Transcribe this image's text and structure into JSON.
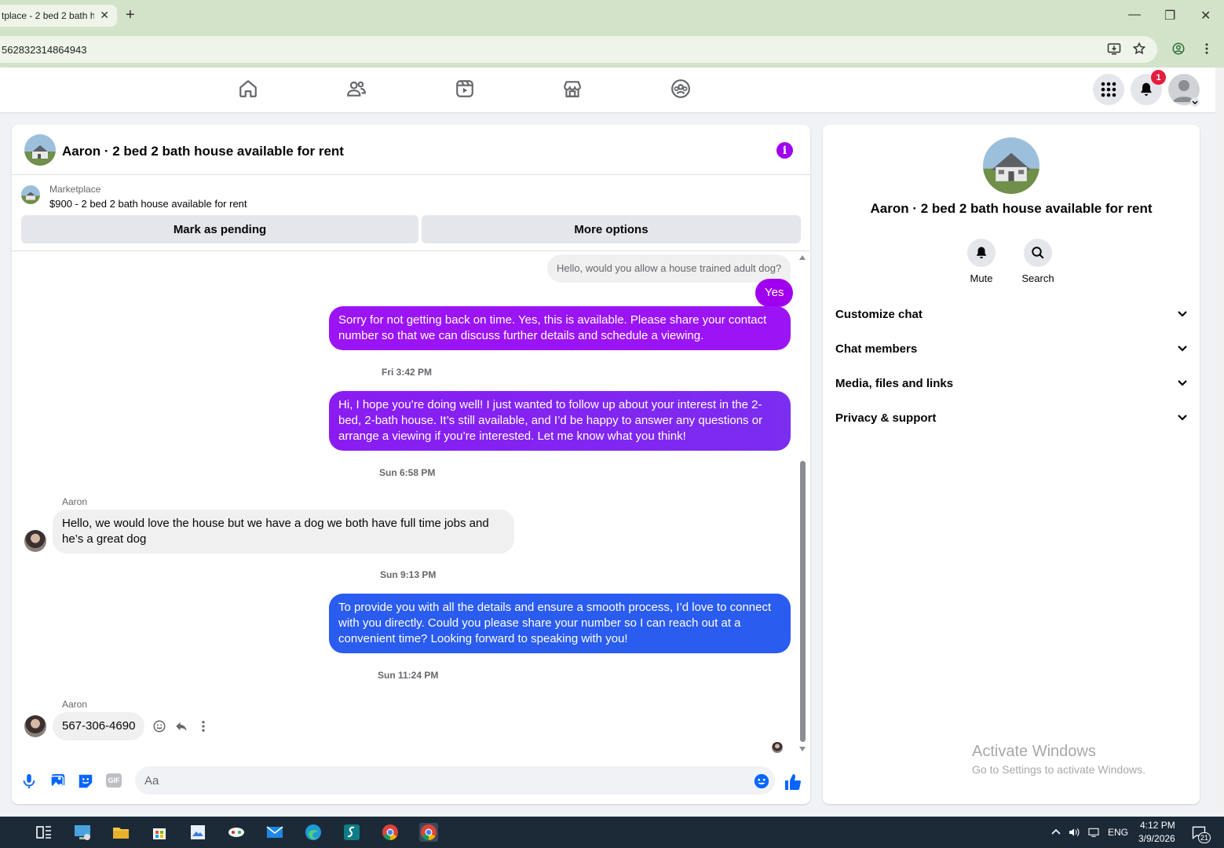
{
  "browser": {
    "tab_title": "tplace - 2 bed 2 bath house available for rent",
    "tab_close": "✕",
    "new_tab": "+",
    "url": "562832314864943",
    "minimize": "—",
    "restore": "❐",
    "close": "✕"
  },
  "nav": {
    "notification_count": "1"
  },
  "chat": {
    "title": "Aaron · 2 bed 2 bath house available for rent",
    "info_glyph": "i",
    "listing": {
      "label": "Marketplace",
      "price_title": "$900 - 2 bed 2 bath house available for rent",
      "mark_pending": "Mark as pending",
      "more_options": "More options"
    },
    "messages": {
      "m1": "Hello, would you allow a house trained adult dog?",
      "m2": "Yes",
      "m3": "Sorry for not getting back on time. Yes, this is available. Please share your contact number so that we can discuss further details and schedule a viewing.",
      "ts1": "Fri 3:42 PM",
      "m4": "Hi, I hope you’re doing well! I just wanted to follow up about your interest in the 2-bed, 2-bath house. It’s still available, and I’d be happy to answer any questions or arrange a viewing if you’re interested. Let me know what you think!",
      "ts2": "Sun 6:58 PM",
      "sender1": "Aaron",
      "m5": "Hello, we would love the house but we have a dog we both have full time jobs and he’s a great dog",
      "ts3": "Sun 9:13 PM",
      "m6": "To provide you with all the details and ensure a smooth process, I’d love to connect with you directly. Could you please share your number so I can reach out at a convenient time? Looking forward to speaking with you!",
      "ts4": "Sun 11:24 PM",
      "sender2": "Aaron",
      "m7": "567-306-4690"
    },
    "composer_placeholder": "Aa",
    "gif_label": "GIF"
  },
  "side": {
    "title": "Aaron · 2 bed 2 bath house available for rent",
    "mute": "Mute",
    "search": "Search",
    "sections": [
      "Customize chat",
      "Chat members",
      "Media, files and links",
      "Privacy & support"
    ]
  },
  "watermark": {
    "line1": "Activate Windows",
    "line2": "Go to Settings to activate Windows."
  },
  "taskbar": {
    "lang": "ENG",
    "time": "4:12 PM",
    "date": "3/9/2026",
    "notif_count": "21"
  },
  "colors": {
    "accent_purple": "#a000f0",
    "bubble_purple": "#9b14f5",
    "bubble_blue": "#2a5cf0",
    "browser_green": "#d3e3c9"
  }
}
